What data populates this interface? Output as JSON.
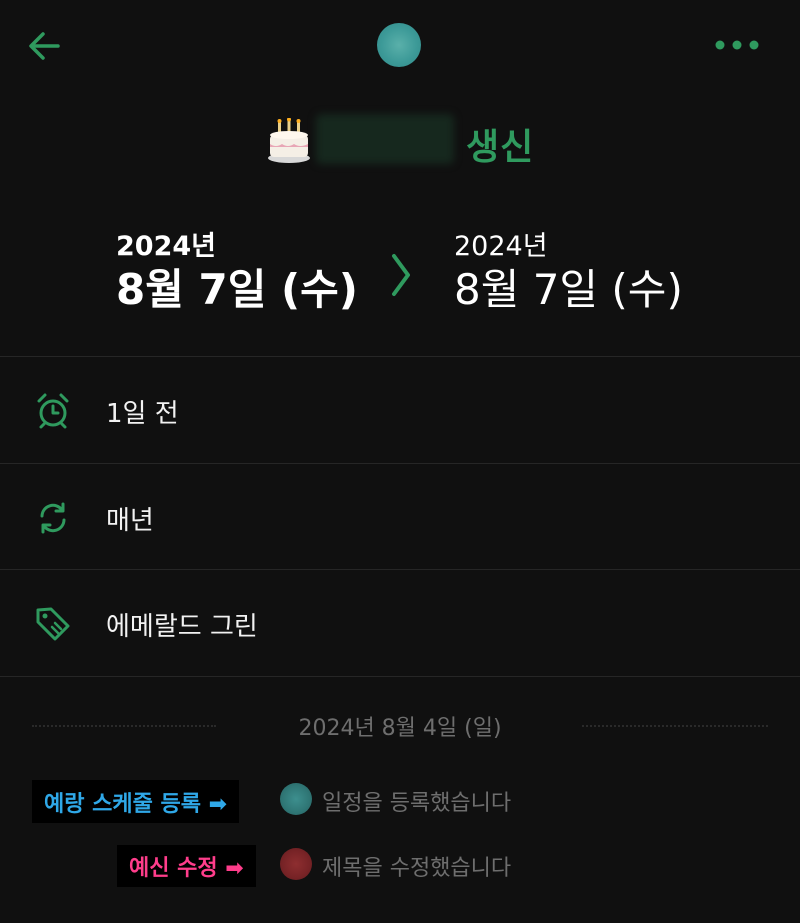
{
  "header": {
    "back_icon": "arrow-left-icon",
    "more_icon": "more-horizontal-icon",
    "accent_color": "#2f9a5e"
  },
  "event": {
    "title_suffix": "생신",
    "emoji_icon": "birthday-cake-icon"
  },
  "dates": {
    "start": {
      "year": "2024년",
      "day": "8월 7일 (수)"
    },
    "end": {
      "year": "2024년",
      "day": "8월 7일 (수)"
    }
  },
  "details": [
    {
      "icon": "alarm-clock-icon",
      "label": "1일 전"
    },
    {
      "icon": "repeat-icon",
      "label": "매년"
    },
    {
      "icon": "tag-icon",
      "label": "에메랄드 그린"
    }
  ],
  "history": {
    "date": "2024년 8월 4일 (일)",
    "entries": [
      {
        "annotation": "예랑 스케줄 등록 ➡",
        "text": "일정을 등록했습니다",
        "dot_color": "#2f7675",
        "annotation_color": "#2fa8e8"
      },
      {
        "annotation": "예신 수정 ➡",
        "text": "제목을 수정했습니다",
        "dot_color": "#772326",
        "annotation_color": "#ff3d8b"
      }
    ]
  }
}
